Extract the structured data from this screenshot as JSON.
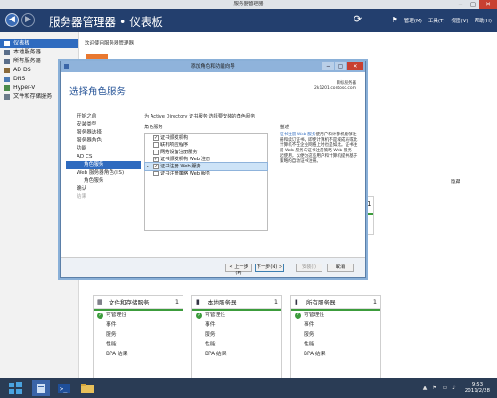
{
  "window": {
    "title": "服务器管理器",
    "min": "−",
    "max": "▢",
    "close": "✕"
  },
  "header": {
    "title": "服务器管理器 • 仪表板",
    "refresh": "⟳",
    "flag": "⚑",
    "menu_manage": "管理(M)",
    "menu_tools": "工具(T)",
    "menu_view": "视图(V)",
    "menu_help": "帮助(H)"
  },
  "sidebar": {
    "items": [
      {
        "label": "仪表板",
        "icon": "dashboard-icon",
        "active": true
      },
      {
        "label": "本地服务器",
        "icon": "server-icon"
      },
      {
        "label": "所有服务器",
        "icon": "servers-icon"
      },
      {
        "label": "AD DS",
        "icon": "ad-icon"
      },
      {
        "label": "DNS",
        "icon": "dns-icon"
      },
      {
        "label": "Hyper-V",
        "icon": "hyperv-icon"
      },
      {
        "label": "文件和存储服务",
        "icon": "storage-icon"
      }
    ]
  },
  "main": {
    "welcome": "欢迎使用服务器管理器",
    "hide": "隐藏",
    "edge_count": "1"
  },
  "dialog": {
    "title": "添加角色和功能向导",
    "heading": "选择角色服务",
    "dest_label": "目标服务器",
    "dest_value": "2k1201.contoso.com",
    "description": "为 Active Directory 证书服务 选择要安装的角色服务",
    "col_roles": "角色服务",
    "col_desc": "描述",
    "steps": [
      {
        "label": "开始之前"
      },
      {
        "label": "安装类型"
      },
      {
        "label": "服务器选择"
      },
      {
        "label": "服务器角色"
      },
      {
        "label": "功能"
      },
      {
        "label": "AD CS"
      },
      {
        "label": "角色服务",
        "sub": true,
        "active": true
      },
      {
        "label": "Web 服务器角色(IIS)"
      },
      {
        "label": "角色服务",
        "sub": true
      },
      {
        "label": "确认"
      },
      {
        "label": "结果",
        "disabled": true
      }
    ],
    "roles": [
      {
        "label": "证书颁发机构",
        "checked": true
      },
      {
        "label": "联机响应程序",
        "checked": false
      },
      {
        "label": "网络设备注册服务",
        "checked": false
      },
      {
        "label": "证书颁发机构 Web 注册",
        "checked": true
      },
      {
        "label": "证书注册 Web 服务",
        "checked": true,
        "selected": true
      },
      {
        "label": "证书注册策略 Web 服务",
        "checked": false
      }
    ],
    "desc_highlight": "证书注册 Web 服务",
    "desc_body": "使用户和计算机能够注册和续订证书，即使计算机不是域成员或此计算机不在企业网络上时也是如此。证书注册 Web 服务与证书注册策略 Web 服务一起使用，以便为这些用户和计算机提供基于策略的自动证书注册。",
    "btn_prev": "< 上一步(P)",
    "btn_next": "下一步(N) >",
    "btn_install": "安装(I)",
    "btn_cancel": "取消"
  },
  "tiles": [
    {
      "name": "文件和存储服务",
      "count": "1",
      "icon": "storage-icon",
      "rows": [
        "可管理性",
        "事件",
        "服务",
        "性能",
        "BPA 结果"
      ]
    },
    {
      "name": "本地服务器",
      "count": "1",
      "icon": "server-icon",
      "rows": [
        "可管理性",
        "事件",
        "服务",
        "性能",
        "BPA 结果"
      ]
    },
    {
      "name": "所有服务器",
      "count": "1",
      "icon": "servers-icon",
      "rows": [
        "可管理性",
        "事件",
        "服务",
        "性能",
        "BPA 结果"
      ]
    }
  ],
  "taskbar": {
    "time": "9:53",
    "date": "2011/2/28",
    "tray": "▲ ⚑ ▭ ♪"
  }
}
